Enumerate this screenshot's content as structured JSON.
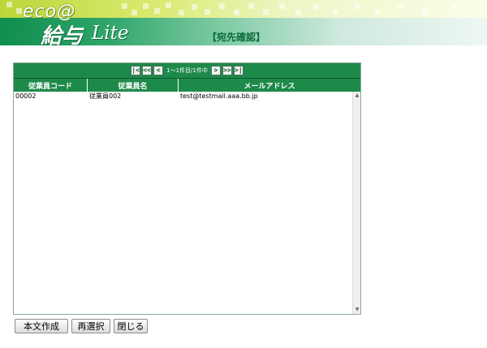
{
  "header": {
    "logo_eco": "eco@",
    "logo_main": "給与",
    "logo_sub": "Lite",
    "page_title": "【宛先確認】"
  },
  "pager": {
    "first_label": "|<",
    "prev_page_label": "<<",
    "prev_label": "<",
    "info": "1～1件目/1件中",
    "next_label": ">",
    "next_page_label": ">>",
    "last_label": ">|"
  },
  "table": {
    "columns": [
      "従業員コード",
      "従業員名",
      "メールアドレス"
    ],
    "rows": [
      {
        "code": "00002",
        "name": "従業員002",
        "email": "test@testmail.aaa.bb.jp"
      }
    ]
  },
  "buttons": {
    "compose": "本文作成",
    "reselect": "再選択",
    "close": "閉じる"
  },
  "colors": {
    "header_green": "#1e8a4a",
    "banner_lime": "#bcd63a"
  },
  "icons": {
    "scroll_up": "▲",
    "scroll_down": "▼"
  }
}
